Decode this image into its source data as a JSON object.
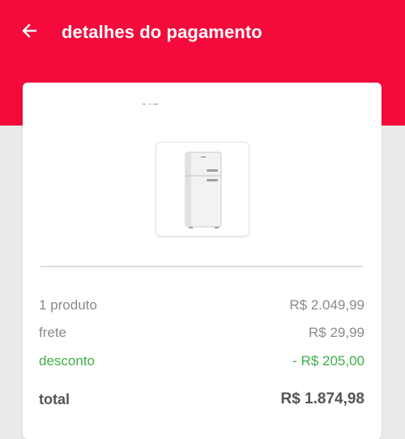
{
  "header": {
    "title": "detalhes do pagamento",
    "background": "#f40b3c"
  },
  "icons": {
    "back": "arrow-left-icon",
    "product": "refrigerator-image"
  },
  "summary": {
    "rows": [
      {
        "label": "1 produto",
        "value": "R$ 2.049,99"
      },
      {
        "label": "frete",
        "value": "R$ 29,99"
      },
      {
        "label": "desconto",
        "value": "- R$ 205,00",
        "color": "#3fae49"
      }
    ],
    "total": {
      "label": "total",
      "value": "R$ 1.874,98"
    }
  }
}
